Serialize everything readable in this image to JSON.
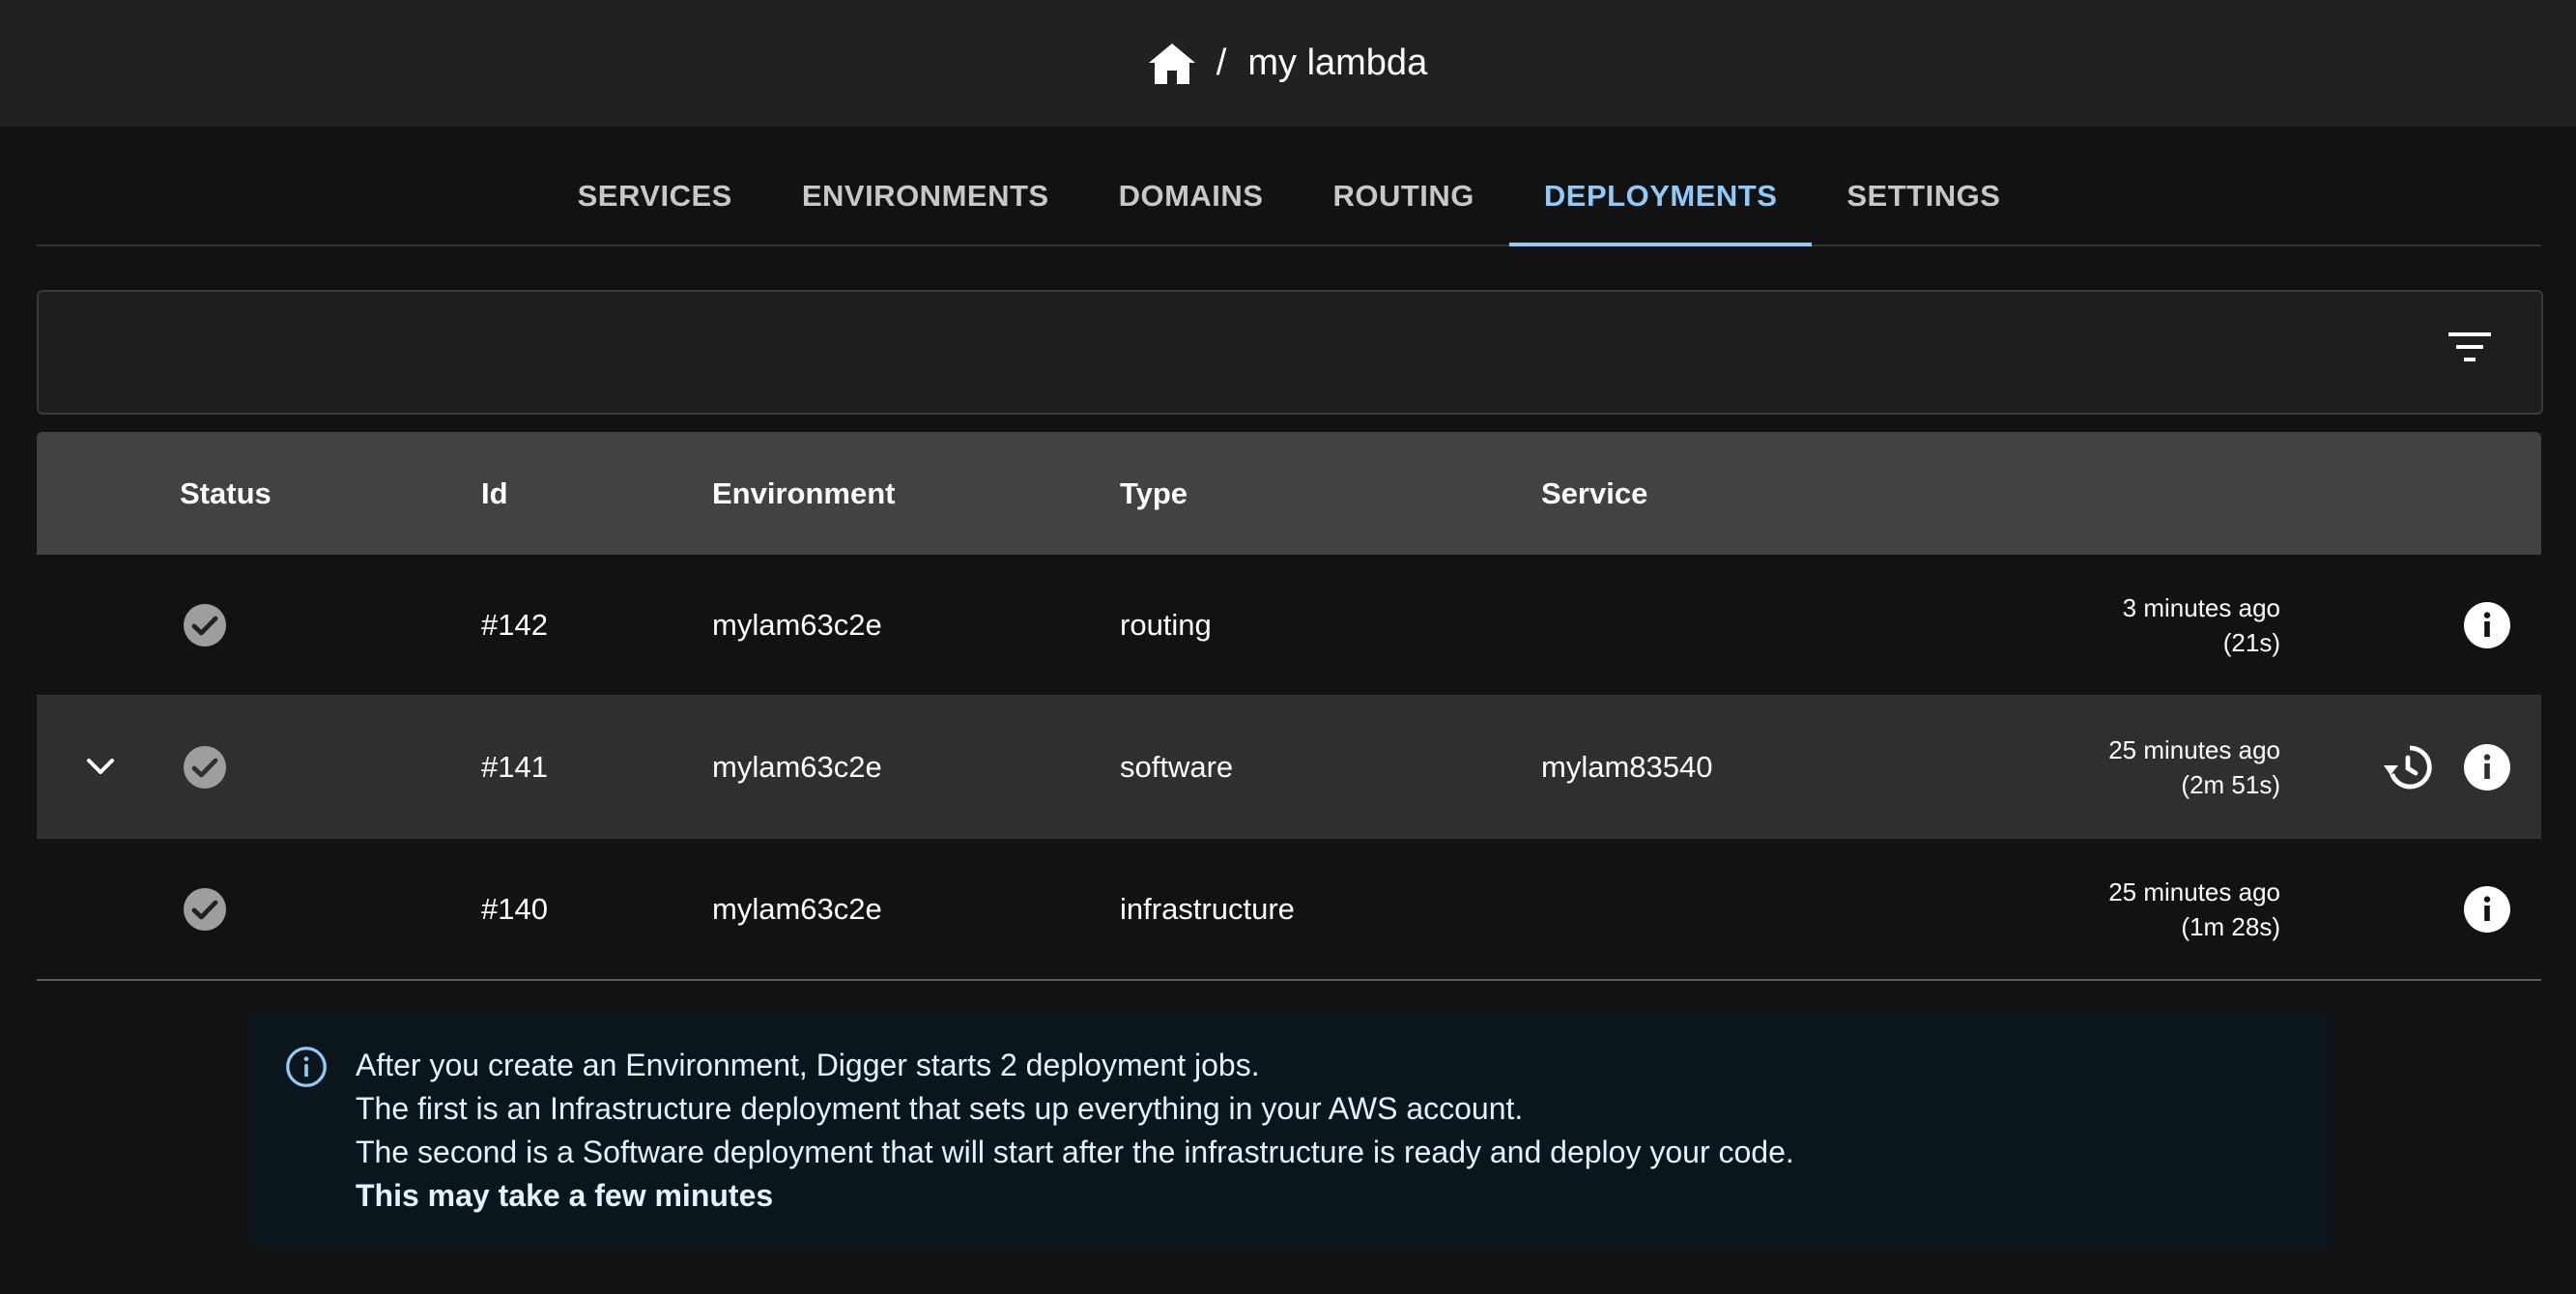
{
  "header": {
    "breadcrumb_separator": "/",
    "breadcrumb_current": "my lambda",
    "home_icon": "home-icon"
  },
  "tabs": [
    {
      "label": "SERVICES",
      "active": false
    },
    {
      "label": "ENVIRONMENTS",
      "active": false
    },
    {
      "label": "DOMAINS",
      "active": false
    },
    {
      "label": "ROUTING",
      "active": false
    },
    {
      "label": "DEPLOYMENTS",
      "active": true
    },
    {
      "label": "SETTINGS",
      "active": false
    }
  ],
  "filter": {
    "icon": "filter-icon"
  },
  "table": {
    "headers": {
      "status": "Status",
      "id": "Id",
      "environment": "Environment",
      "type": "Type",
      "service": "Service"
    },
    "rows": [
      {
        "status": "success",
        "id": "#142",
        "environment": "mylam63c2e",
        "type": "routing",
        "service": "",
        "time_ago": "3 minutes ago",
        "duration": "(21s)",
        "expandable": false,
        "has_history": false
      },
      {
        "status": "success",
        "id": "#141",
        "environment": "mylam63c2e",
        "type": "software",
        "service": "mylam83540",
        "time_ago": "25 minutes ago",
        "duration": "(2m 51s)",
        "expandable": true,
        "has_history": true
      },
      {
        "status": "success",
        "id": "#140",
        "environment": "mylam63c2e",
        "type": "infrastructure",
        "service": "",
        "time_ago": "25 minutes ago",
        "duration": "(1m 28s)",
        "expandable": false,
        "has_history": false
      }
    ]
  },
  "alert": {
    "line1": "After you create an Environment, Digger starts 2 deployment jobs.",
    "line2": "The first is an Infrastructure deployment that sets up everything in your AWS account.",
    "line3": "The second is a Software deployment that will start after the infrastructure is ready and deploy your code.",
    "line4": "This may take a few minutes"
  },
  "colors": {
    "accent": "#90caf9",
    "background": "#121212",
    "header_bg": "#212121",
    "table_header_bg": "#424242",
    "alert_bg": "#0b151c"
  }
}
